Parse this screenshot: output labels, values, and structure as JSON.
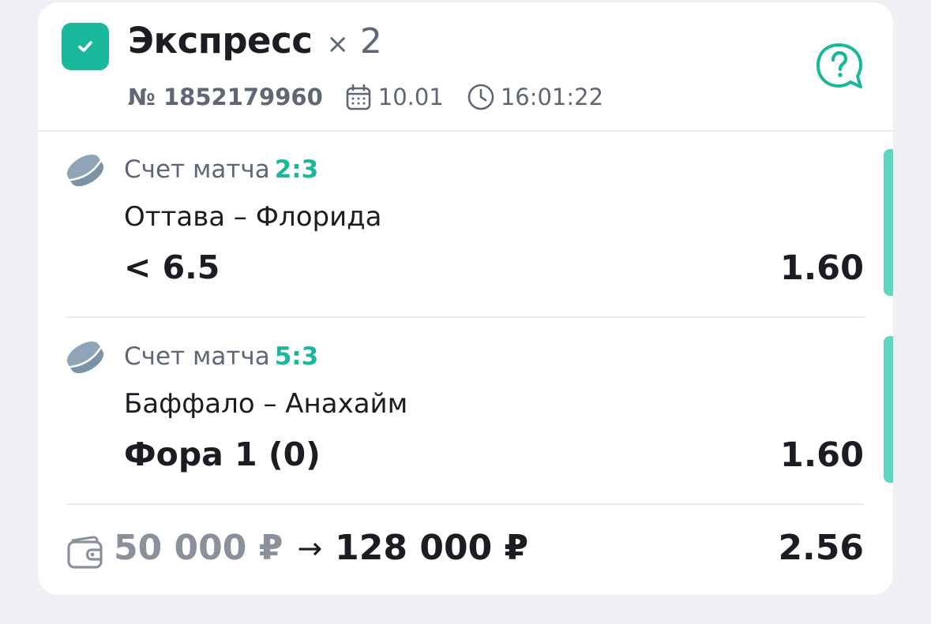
{
  "bet": {
    "selected": true,
    "title": "Экспресс",
    "multiplier_symbol": "×",
    "multiplier_count": "2",
    "number": "№ 1852179960",
    "date": "10.01",
    "time": "16:01:22"
  },
  "icons": {
    "checkbox": "check-icon",
    "help": "question-chat-icon",
    "calendar": "calendar-icon",
    "clock": "clock-icon",
    "sport": "hockey-puck-icon",
    "wallet": "wallet-icon"
  },
  "events": [
    {
      "score_label": "Счет матча",
      "score": "2:3",
      "teams": "Оттава – Флорида",
      "outcome": "< 6.5",
      "odds": "1.60"
    },
    {
      "score_label": "Счет матча",
      "score": "5:3",
      "teams": "Баффало – Анахайм",
      "outcome": "Фора 1 (0)",
      "odds": "1.60"
    }
  ],
  "footer": {
    "stake": "50 000 ₽",
    "arrow": "→",
    "payout": "128 000 ₽",
    "total_odds": "2.56"
  },
  "colors": {
    "accent": "#19b89b",
    "accent_bar": "#5fd6c1",
    "muted_text": "#5f6774",
    "primary_text": "#1c1d22",
    "background": "#eef0f4",
    "card": "#ffffff"
  }
}
